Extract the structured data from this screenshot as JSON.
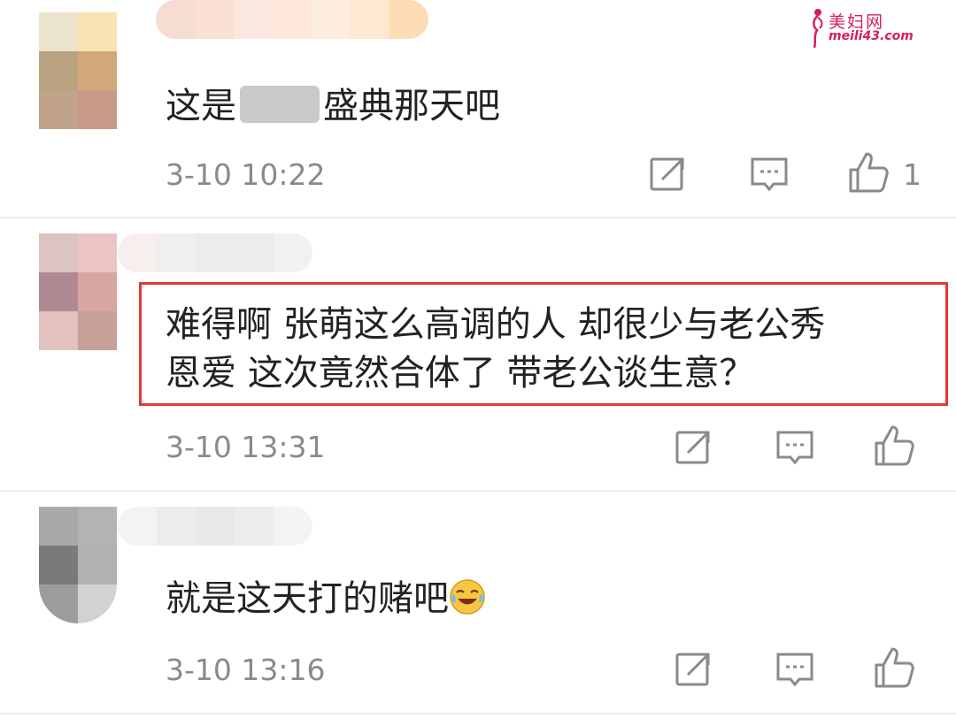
{
  "watermark": {
    "line1": "美妇网",
    "line2": "meili43.com"
  },
  "comments": [
    {
      "text_before": "这是",
      "text_after": "盛典那天吧",
      "time": "3-10 10:22",
      "like_count": "1",
      "actions": [
        "share-icon",
        "reply-icon",
        "like-icon"
      ]
    },
    {
      "text_line1": "难得啊  张萌这么高调的人  却很少与老公秀",
      "text_line2": "恩爱  这次竟然合体了  带老公谈生意？",
      "time": "3-10 13:31",
      "highlighted": true,
      "highlight_color": "#e53935",
      "actions": [
        "share-icon",
        "reply-icon",
        "like-icon"
      ]
    },
    {
      "text": "就是这天打的赌吧",
      "emoji": "laughing-tears-emoji",
      "time": "3-10 13:16",
      "actions": [
        "share-icon",
        "reply-icon",
        "like-icon"
      ]
    }
  ]
}
